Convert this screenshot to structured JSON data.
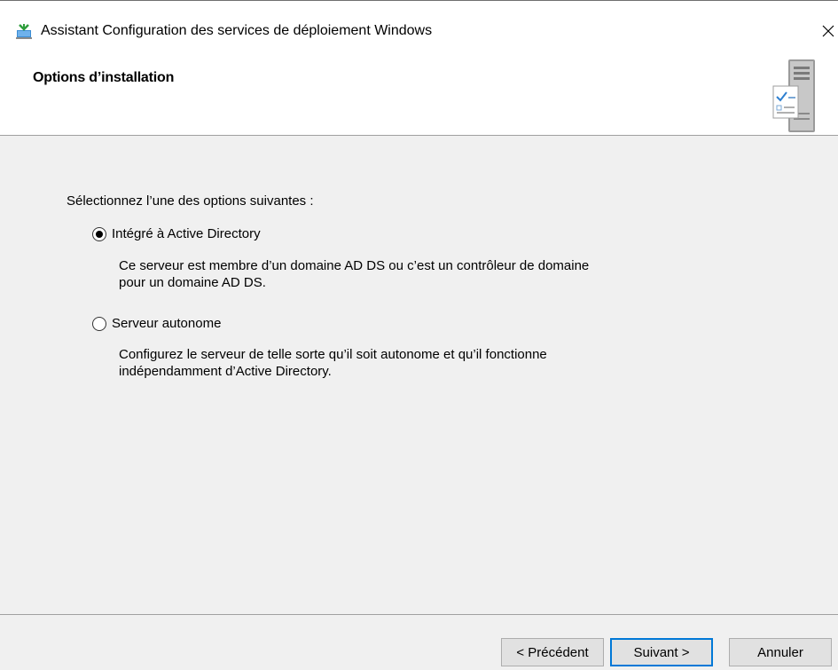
{
  "window": {
    "title": "Assistant Configuration des services de déploiement Windows",
    "close_label": "×"
  },
  "header": {
    "title": "Options d’installation"
  },
  "main": {
    "instruction": "Sélectionnez l’une des options suivantes :",
    "options": [
      {
        "label": "Intégré à Active Directory",
        "selected": true,
        "description_lines": [
          "Ce serveur est membre d’un domaine AD DS ou c’est un contrôleur de domaine",
          "pour un domaine AD DS."
        ]
      },
      {
        "label": "Serveur autonome",
        "selected": false,
        "description_lines": [
          "Configurez le serveur de telle sorte qu’il soit autonome et qu’il fonctionne",
          "indépendamment d’Active Directory."
        ]
      }
    ]
  },
  "footer": {
    "previous_label": "< Précédent",
    "next_label": "Suivant >",
    "cancel_label": "Annuler"
  },
  "colors": {
    "accent": "#0078d7",
    "panel": "#f0f0f0"
  }
}
